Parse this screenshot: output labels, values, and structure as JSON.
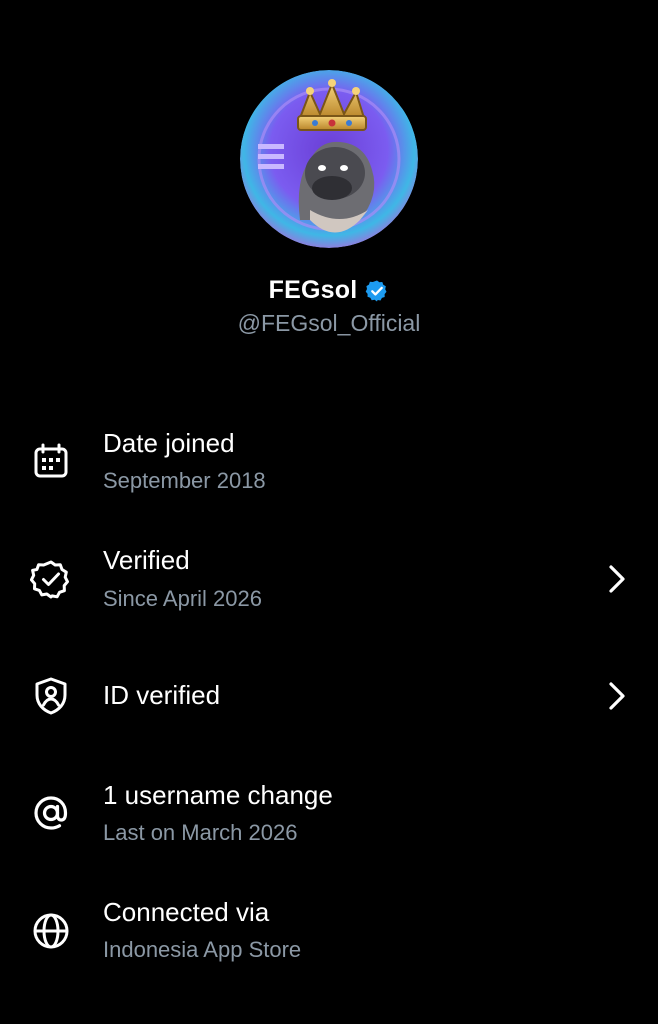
{
  "profile": {
    "display_name": "FEGsol",
    "handle": "@FEGsol_Official",
    "verified": true,
    "avatar": "crowned-gorilla-logo",
    "badge_color": "#1d9bf0"
  },
  "info_rows": [
    {
      "icon": "calendar-icon",
      "title": "Date joined",
      "subtitle": "September 2018",
      "has_chevron": false
    },
    {
      "icon": "verified-check-icon",
      "title": "Verified",
      "subtitle": "Since April 2026",
      "has_chevron": true
    },
    {
      "icon": "id-shield-icon",
      "title": "ID verified",
      "subtitle": "",
      "has_chevron": true
    },
    {
      "icon": "at-sign-icon",
      "title": "1 username change",
      "subtitle": "Last on March 2026",
      "has_chevron": false
    },
    {
      "icon": "globe-icon",
      "title": "Connected via",
      "subtitle": "Indonesia App Store",
      "has_chevron": false
    }
  ],
  "colors": {
    "background": "#000000",
    "primary_text": "#ffffff",
    "secondary_text": "#8b98a5",
    "accent": "#1d9bf0"
  }
}
